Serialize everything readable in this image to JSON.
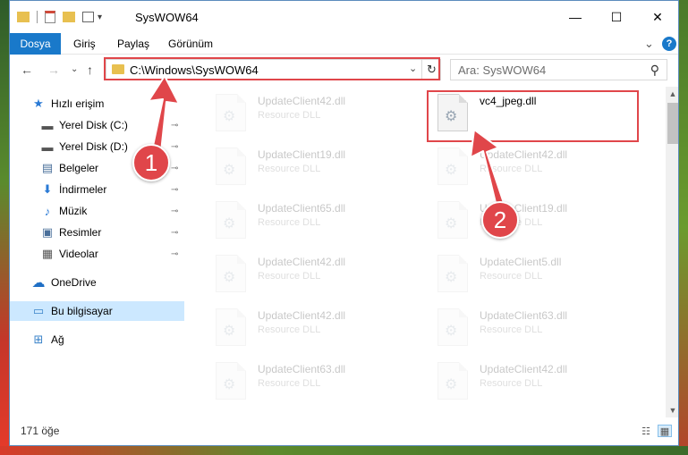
{
  "window": {
    "title": "SysWOW64",
    "minimize": "—",
    "maximize": "☐",
    "close": "✕"
  },
  "ribbon": {
    "tabs": [
      "Dosya",
      "Giriş",
      "Paylaş",
      "Görünüm"
    ],
    "expand": "⌄",
    "help": "?"
  },
  "address": {
    "back": "←",
    "forward": "→",
    "recent": "⌄",
    "up": "↑",
    "path": "C:\\Windows\\SysWOW64",
    "dropdown": "⌄",
    "refresh": "↻",
    "search_placeholder": "Ara: SysWOW64",
    "search_icon": "⚲"
  },
  "sidebar": {
    "items": [
      {
        "label": "Hızlı erişim",
        "icon": "star-icon",
        "glyph": "★",
        "pinned": false
      },
      {
        "label": "Yerel Disk (C:)",
        "icon": "drive-icon",
        "glyph": "▬",
        "pinned": true
      },
      {
        "label": "Yerel Disk (D:)",
        "icon": "drive-icon",
        "glyph": "▬",
        "pinned": true
      },
      {
        "label": "Belgeler",
        "icon": "documents-icon",
        "glyph": "▤",
        "pinned": true
      },
      {
        "label": "İndirmeler",
        "icon": "download-icon",
        "glyph": "⬇",
        "pinned": true
      },
      {
        "label": "Müzik",
        "icon": "music-icon",
        "glyph": "♪",
        "pinned": true
      },
      {
        "label": "Resimler",
        "icon": "pictures-icon",
        "glyph": "▣",
        "pinned": true
      },
      {
        "label": "Videolar",
        "icon": "video-icon",
        "glyph": "▦",
        "pinned": true
      },
      {
        "label": "OneDrive",
        "icon": "cloud-icon",
        "glyph": "☁",
        "pinned": false
      },
      {
        "label": "Bu bilgisayar",
        "icon": "computer-icon",
        "glyph": "▭",
        "pinned": false
      },
      {
        "label": "Ağ",
        "icon": "network-icon",
        "glyph": "⊞",
        "pinned": false
      }
    ],
    "pin_glyph": "📌"
  },
  "files": {
    "left_column": [
      {
        "name": "UpdateClient42.dll",
        "type": "Resource DLL"
      },
      {
        "name": "UpdateClient19.dll",
        "type": "Resource DLL"
      },
      {
        "name": "UpdateClient65.dll",
        "type": "Resource DLL"
      },
      {
        "name": "UpdateClient42.dll",
        "type": "Resource DLL"
      },
      {
        "name": "UpdateClient42.dll",
        "type": "Resource DLL"
      },
      {
        "name": "UpdateClient63.dll",
        "type": "Resource DLL"
      }
    ],
    "right_column": [
      {
        "name": "vc4_jpeg.dll",
        "type": ""
      },
      {
        "name": "UpdateClient42.dll",
        "type": "Resource DLL"
      },
      {
        "name": "UpdateClient19.dll",
        "type": "Resource DLL"
      },
      {
        "name": "UpdateClient5.dll",
        "type": "Resource DLL"
      },
      {
        "name": "UpdateClient63.dll",
        "type": "Resource DLL"
      },
      {
        "name": "UpdateClient42.dll",
        "type": "Resource DLL"
      }
    ],
    "gear_glyph": "⚙"
  },
  "status": {
    "count": "171 öğe",
    "details_view": "☷",
    "icons_view": "▦"
  },
  "scroll": {
    "up": "▲",
    "down": "▼"
  },
  "annotations": {
    "step1": "1",
    "step2": "2",
    "color": "#e0464a"
  }
}
